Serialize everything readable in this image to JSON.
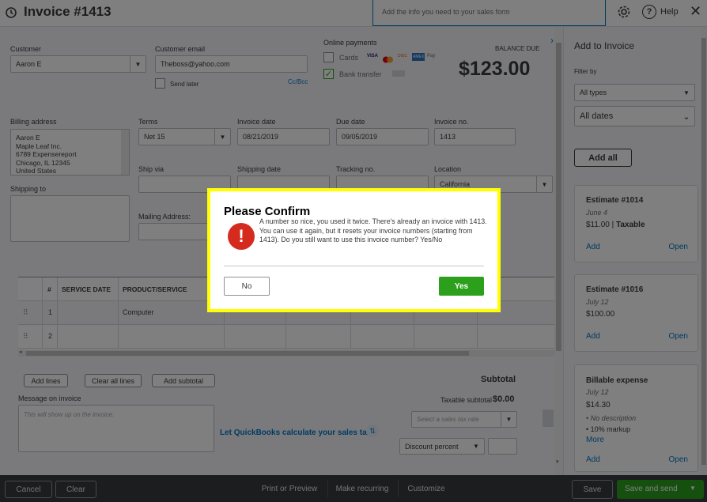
{
  "header": {
    "title": "Invoice #1413",
    "hint": "Add the info you need to your sales form",
    "help_label": "Help"
  },
  "customer": {
    "label": "Customer",
    "value": "Aaron E",
    "email_label": "Customer email",
    "email_value": "Theboss@yahoo.com",
    "send_later": "Send later",
    "cc_bcc": "Cc/Bcc"
  },
  "online_payments": {
    "label": "Online payments",
    "cards": "Cards",
    "bank_transfer": "Bank transfer",
    "card_logos": [
      "VISA",
      "MC",
      "DISC",
      "AMEX",
      "Pay"
    ]
  },
  "balance": {
    "label": "BALANCE DUE",
    "amount": "$123.00"
  },
  "billing": {
    "label": "Billing address",
    "lines": [
      "Aaron E",
      "Maple Leaf Inc.",
      "6789 Expensereport",
      "Chicago, IL  12345",
      "United States"
    ]
  },
  "terms": {
    "label": "Terms",
    "value": "Net 15"
  },
  "invoice_date": {
    "label": "Invoice date",
    "value": "08/21/2019"
  },
  "due_date": {
    "label": "Due date",
    "value": "09/05/2019"
  },
  "invoice_no": {
    "label": "Invoice no.",
    "value": "1413"
  },
  "ship_via": {
    "label": "Ship via"
  },
  "shipping_date": {
    "label": "Shipping date"
  },
  "tracking": {
    "label": "Tracking no."
  },
  "location": {
    "label": "Location",
    "value": "California"
  },
  "shipping_to": {
    "label": "Shipping to"
  },
  "mailing": {
    "label": "Mailing Address:"
  },
  "table": {
    "headers": [
      "#",
      "SERVICE DATE",
      "PRODUCT/SERVICE"
    ],
    "rows": [
      {
        "num": "1",
        "product": "Computer"
      },
      {
        "num": "2",
        "product": ""
      }
    ]
  },
  "actions": {
    "add_lines": "Add lines",
    "clear_all_lines": "Clear all lines",
    "add_subtotal": "Add subtotal"
  },
  "message": {
    "label": "Message on invoice",
    "placeholder": "This will show up on the invoice."
  },
  "tax": {
    "link": "Let QuickBooks calculate your sales tax",
    "subtotal_label": "Subtotal",
    "taxable_subtotal_label": "Taxable subtotal",
    "taxable_subtotal_value": "$0.00",
    "rate_placeholder": "Select a sales tax rate",
    "discount": "Discount percent"
  },
  "sidebar": {
    "title": "Add to Invoice",
    "filter_label": "Filter by",
    "type_filter": "All types",
    "date_filter": "All dates",
    "add_all": "Add all",
    "cards": [
      {
        "title": "Estimate #1014",
        "date": "June 4",
        "amount": "$11.00",
        "tag": "Taxable",
        "add": "Add",
        "open": "Open"
      },
      {
        "title": "Estimate #1016",
        "date": "July 12",
        "amount": "$100.00",
        "add": "Add",
        "open": "Open"
      },
      {
        "title": "Billable expense",
        "date": "July 12",
        "amount": "$14.30",
        "bullet1": "No description",
        "bullet2": "10% markup",
        "more": "More",
        "add": "Add",
        "open": "Open"
      }
    ]
  },
  "footer": {
    "cancel": "Cancel",
    "clear": "Clear",
    "print_preview": "Print or Preview",
    "make_recurring": "Make recurring",
    "customize": "Customize",
    "save": "Save",
    "save_and_send": "Save and send"
  },
  "dialog": {
    "title": "Please Confirm",
    "message": "A number so nice, you used it twice. There's already an invoice with 1413. You can use it again, but it resets your invoice numbers (starting from 1413). Do you still want to use this invoice number? Yes/No",
    "no": "No",
    "yes": "Yes",
    "highlight_color": "#ffff00",
    "yes_color": "#2ca01c",
    "error_color": "#d52b1e"
  }
}
